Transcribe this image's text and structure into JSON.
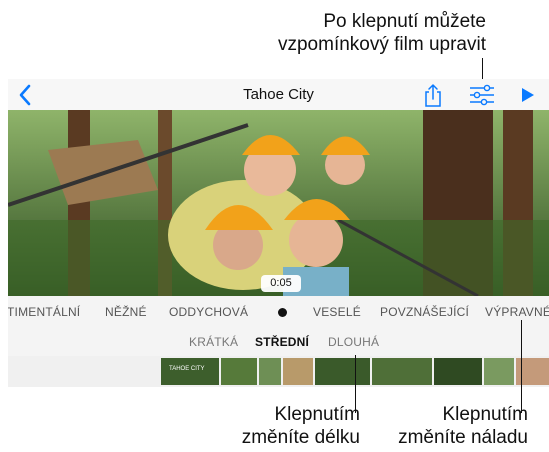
{
  "callouts": {
    "edit": [
      "Po klepnutí můžete",
      "vzpomínkový film upravit"
    ],
    "length": [
      "Klepnutím",
      "změníte délku"
    ],
    "mood": [
      "Klepnutím",
      "změníte náladu"
    ]
  },
  "navbar": {
    "title": "Tahoe City",
    "back_icon": "chevron-left-icon",
    "share_icon": "share-icon",
    "edit_icon": "sliders-icon",
    "play_icon": "play-icon"
  },
  "video": {
    "time": "0:05"
  },
  "moods": {
    "items": [
      "TIMENTÁLNÍ",
      "NĚŽNÉ",
      "ODDYCHOVÁ",
      "VESELÉ",
      "POVZNÁŠEJÍCÍ",
      "VÝPRAVNÉ"
    ],
    "selected_indicator": "dot-icon"
  },
  "lengths": {
    "items": [
      "KRÁTKÁ",
      "STŘEDNÍ",
      "DLOUHÁ"
    ],
    "selected": "STŘEDNÍ"
  },
  "filmstrip": {
    "first_thumb_label": "TAHOE CITY"
  },
  "colors": {
    "accent": "#0a7aff",
    "text": "#111111",
    "helmet": "#f2a21a"
  }
}
